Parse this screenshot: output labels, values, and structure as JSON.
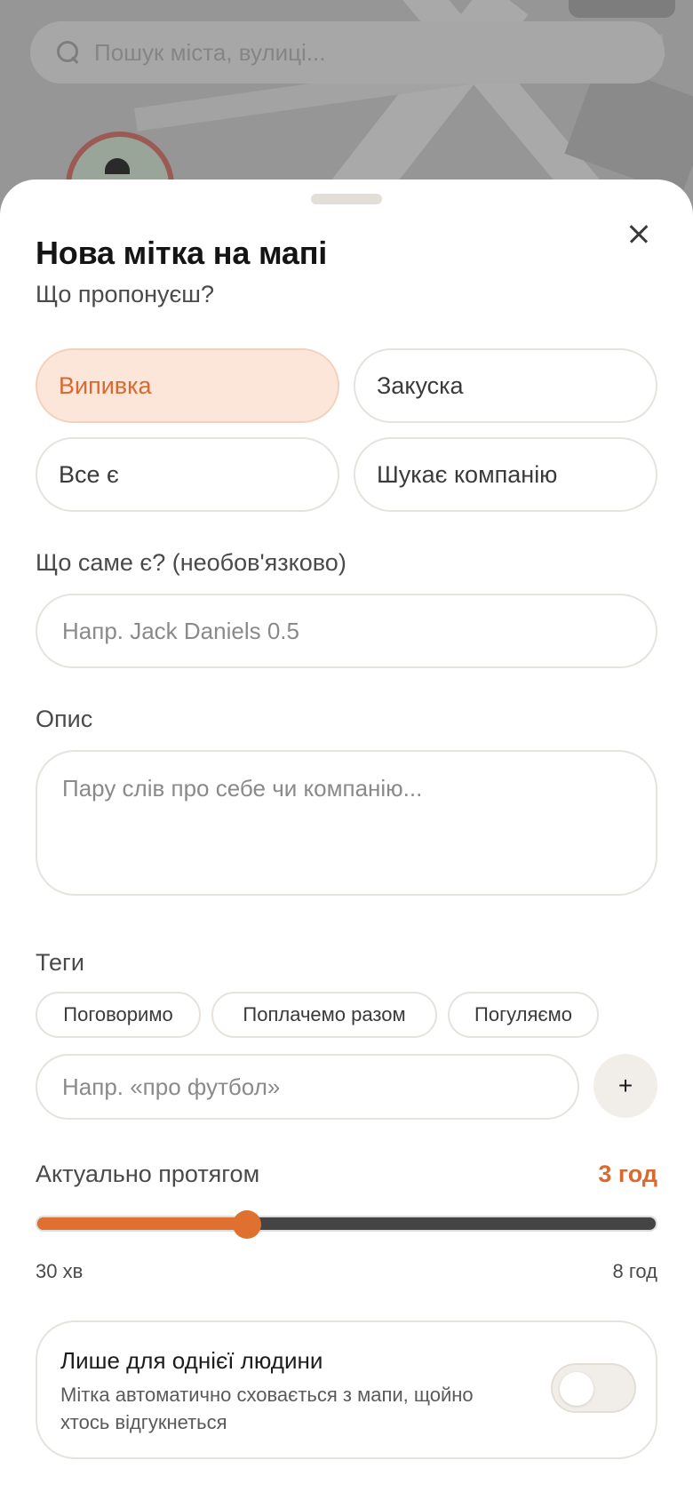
{
  "map": {
    "search_placeholder": "Пошук міста, вулиці..."
  },
  "sheet": {
    "title": "Нова мітка на мапі",
    "offer_label": "Що пропонуєш?",
    "offer_options": [
      {
        "label": "Випивка",
        "selected": true
      },
      {
        "label": "Закуска",
        "selected": false
      },
      {
        "label": "Все є",
        "selected": false
      },
      {
        "label": "Шукає компанію",
        "selected": false
      }
    ],
    "what_label": "Що саме є? (необов'язково)",
    "what_placeholder": "Напр. Jack Daniels 0.5",
    "desc_label": "Опис",
    "desc_placeholder": "Пару слів про себе чи компанію...",
    "tags_label": "Теги",
    "tags": [
      "Поговоримо",
      "Поплачемо разом",
      "Погуляємо"
    ],
    "tag_placeholder": "Напр. «про футбол»",
    "add_tag_symbol": "+",
    "duration": {
      "label": "Актуально протягом",
      "value_text": "3 год",
      "min_label": "30 хв",
      "max_label": "8 год",
      "fraction": 0.34
    },
    "single_person": {
      "title": "Лише для однієї людини",
      "description": "Мітка автоматично сховається з мапи, щойно хтось відгукнеться",
      "enabled": false
    }
  },
  "colors": {
    "accent": "#e0702f",
    "selected_bg": "#fce6d9"
  }
}
